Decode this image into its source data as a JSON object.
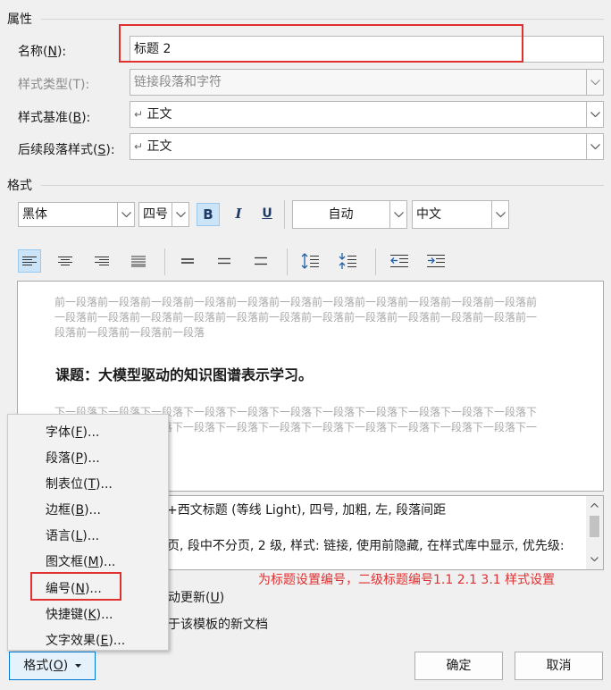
{
  "properties": {
    "section_title": "属性",
    "name": {
      "label_prefix": "名称(",
      "label_key": "N",
      "label_suffix": "):",
      "value": "标题 2"
    },
    "style_type": {
      "label": "样式类型(T):",
      "value": "链接段落和字符"
    },
    "style_based_on": {
      "label_prefix": "样式基准(",
      "label_key": "B",
      "label_suffix": "):",
      "value_prefix": "↵",
      "value": "正文"
    },
    "following_style": {
      "label_prefix": "后续段落样式(",
      "label_key": "S",
      "label_suffix": "):",
      "value_prefix": "↵",
      "value": "正文"
    }
  },
  "format": {
    "section_title": "格式",
    "font": "黑体",
    "size": "四号",
    "bold_label": "B",
    "italic_label": "I",
    "underline_label": "U",
    "color": "自动",
    "script": "中文"
  },
  "preview": {
    "prev_paragraph": "前一段落前一段落前一段落前一段落前一段落前一段落前一段落前一段落前一段落前一段落前一段落前一段落前一段落前一段落前一段落前一段落前一段落前一段落前一段落前一段落前一段落前一段落前一段落前一段落前一段落前一段落",
    "sample_text": "课题：大模型驱动的知识图谱表示学习。",
    "next_paragraph": "下一段落下一段落下一段落下一段落下一段落下一段落下一段落下一段落下一段落下一段落下一段落下一段落下一段落下一段落下一段落下一段落下一段落下一段落下一段落下一段落下一段落下一段落下一段落下一段落"
  },
  "description": {
    "line1": "+西文标题 (等线 Light), 四号, 加粗, 左, 段落间距",
    "line2": "页, 段中不分页, 2 级, 样式: 链接, 使用前隐藏, 在样式库中显示, 优先级:"
  },
  "annotation": "为标题设置编号，二级标题编号1.1 2.1 3.1 样式设置",
  "options": {
    "auto_update": {
      "label_prefix": "动更新(",
      "label_key": "U",
      "label_suffix": ")"
    },
    "template": {
      "label": "于该模板的新文档"
    }
  },
  "format_menu": {
    "items": [
      {
        "prefix": "字体(",
        "key": "F",
        "suffix": ")..."
      },
      {
        "prefix": "段落(",
        "key": "P",
        "suffix": ")..."
      },
      {
        "prefix": "制表位(",
        "key": "T",
        "suffix": ")..."
      },
      {
        "prefix": "边框(",
        "key": "B",
        "suffix": ")..."
      },
      {
        "prefix": "语言(",
        "key": "L",
        "suffix": ")..."
      },
      {
        "prefix": "图文框(",
        "key": "M",
        "suffix": ")..."
      },
      {
        "prefix": "编号(",
        "key": "N",
        "suffix": ")..."
      },
      {
        "prefix": "快捷键(",
        "key": "K",
        "suffix": ")..."
      },
      {
        "prefix": "文字效果(",
        "key": "E",
        "suffix": ")..."
      }
    ]
  },
  "buttons": {
    "format": {
      "prefix": "格式(",
      "key": "O",
      "suffix": ")"
    },
    "ok": "确定",
    "cancel": "取消"
  },
  "colors": {
    "accent": "#cce4f7",
    "highlight": "#e03030",
    "annotation": "#e03030"
  }
}
